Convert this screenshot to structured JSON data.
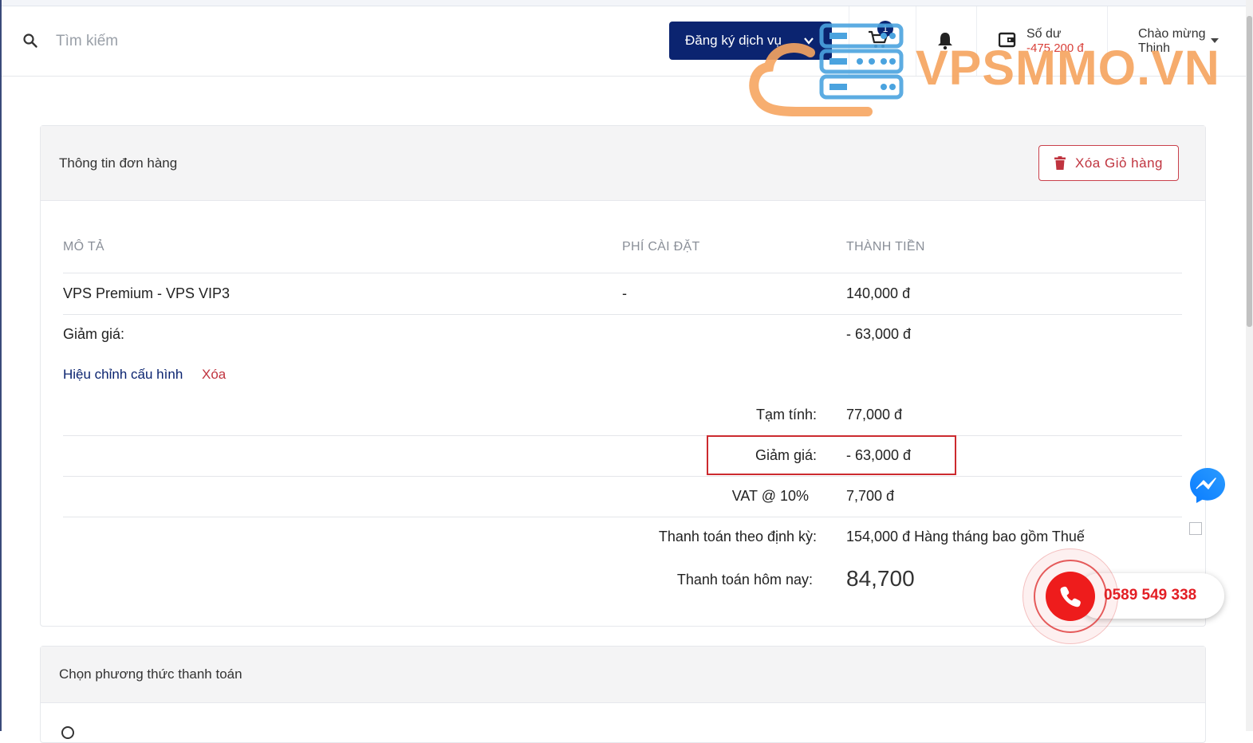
{
  "header": {
    "search_placeholder": "Tìm kiếm",
    "register_label": "Đăng ký dịch vụ",
    "cart_count": "1",
    "balance_label": "Số dư",
    "balance_value": "-475,200 đ",
    "welcome_line1": "Chào mừng",
    "welcome_line2": "Thịnh",
    "logo_text": "VPSMMO.VN"
  },
  "order": {
    "title": "Thông tin đơn hàng",
    "clear_cart_label": "Xóa Giỏ hàng",
    "columns": {
      "description": "MÔ TẢ",
      "setup_fee": "PHÍ CÀI ĐẶT",
      "amount": "THÀNH TIỀN"
    },
    "item": {
      "name": "VPS Premium - VPS VIP3",
      "setup_fee": "-",
      "amount": "140,000 đ"
    },
    "discount_row": {
      "label": "Giảm giá:",
      "amount": "- 63,000 đ"
    },
    "edit_config_label": "Hiệu chỉnh cấu hình",
    "remove_label": "Xóa",
    "summary": {
      "subtotal_label": "Tạm tính:",
      "subtotal_value": "77,000 đ",
      "discount_label": "Giảm giá:",
      "discount_value": "- 63,000 đ",
      "vat_label": "VAT @ 10%",
      "vat_value": "7,700 đ",
      "recurring_label": "Thanh toán theo định kỳ:",
      "recurring_value": "154,000 đ Hàng tháng bao gồm Thuế",
      "today_label": "Thanh toán hôm nay:",
      "today_value": "84,700"
    }
  },
  "payment": {
    "title": "Chọn phương thức thanh toán"
  },
  "contact": {
    "phone": "0589 549 338"
  },
  "colors": {
    "primary": "#0b2470",
    "danger": "#c0343f",
    "highlight": "#cc2a2f",
    "logo": "#f6a561"
  }
}
